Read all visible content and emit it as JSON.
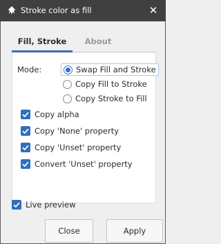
{
  "window": {
    "title": "Stroke color as fill"
  },
  "tabs": [
    {
      "label": "Fill, Stroke",
      "active": true
    },
    {
      "label": "About",
      "active": false
    }
  ],
  "mode": {
    "label": "Mode:",
    "options": [
      {
        "label": "Swap Fill and Stroke",
        "selected": true
      },
      {
        "label": "Copy Fill to Stroke",
        "selected": false
      },
      {
        "label": "Copy Stroke to Fill",
        "selected": false
      }
    ]
  },
  "checkboxes": [
    {
      "label": "Copy alpha",
      "checked": true
    },
    {
      "label": "Copy 'None' property",
      "checked": true
    },
    {
      "label": "Copy 'Unset' property",
      "checked": true
    },
    {
      "label": "Convert 'Unset' property",
      "checked": true
    }
  ],
  "live_preview": {
    "label": "Live preview",
    "checked": true
  },
  "buttons": {
    "close": "Close",
    "apply": "Apply"
  },
  "icons": {
    "app": "inkscape-app-icon",
    "close": "close-icon",
    "check": "checkmark-icon"
  },
  "colors": {
    "titlebar": "#404040",
    "accent": "#2f6fbd",
    "tab_underline": "#3e6fb0"
  }
}
